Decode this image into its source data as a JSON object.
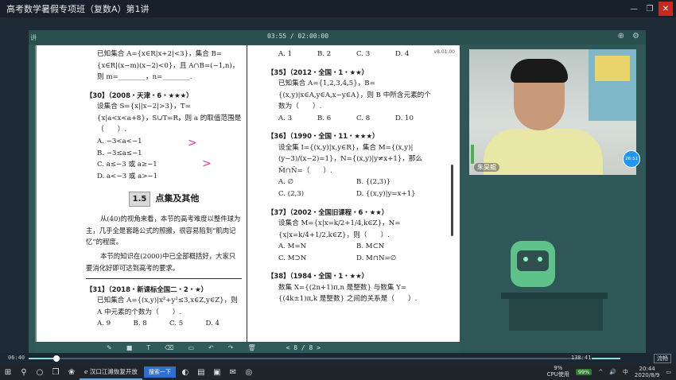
{
  "window": {
    "title": "高考数学暑假专项班（复数A）第1讲"
  },
  "player": {
    "back_label": "讲",
    "time": "03:55 / 02:00:00",
    "doc_corner": "v8.01.00"
  },
  "doc": {
    "left": {
      "q_prev_stem": "已知集合 A={x∈R|x+2|<3}，集合 B={x∈R|(x−m)(x−2)<0}，且 A∩B=(−1,n)，则 m=________，n=________.",
      "q30_head": "【30】（2008・天津・6・★★★）",
      "q30_stem": "设集合 S={x||x−2|>3}，T={x|a<x<a+8}，S∪T=R，则 a 的取值范围是（　　）.",
      "q30_options": [
        "A.  −3<a<−1",
        "B.  −3≤a≤−1",
        "C.  a≤−3 或 a≥−1",
        "D.  a<−3 或 a>−1"
      ],
      "section_num": "1.5",
      "section_title": "点集及其他",
      "para1": "从(40)的视角来看，本节的高考难度以整件球为主，几乎全是套路公式的照搬，很容易陷到“肌肉记忆”的程度。",
      "para2": "本节的知识在(2000)中已全部概括好，大家只要消化好即可达到高考的要求。",
      "q31_head": "【31】（2018・新课标全国二・2・★）",
      "q31_stem": "已知集合 A={(x,y)|x²+y²≤3,x∈Z,y∈Z}，则 A 中元素的个数为（　　）.",
      "q31_options": [
        "A.  9",
        "B.  8",
        "C.  5",
        "D.  4"
      ]
    },
    "right": {
      "q_prev_options": [
        "A.  1",
        "B.  2",
        "C.  3",
        "D.  4"
      ],
      "q35_head": "【35】（2012・全国・1・★★）",
      "q35_stem": "已知集合 A={1,2,3,4,5}，B={(x,y)|x∈A,y∈A,x−y∈A}，则 B 中所含元素的个数为（　　）.",
      "q35_options": [
        "A.  3",
        "B.  6",
        "C.  8",
        "D.  10"
      ],
      "q36_head": "【36】（1990・全国・11・★★★）",
      "q36_stem": "设全集 I={(x,y)|x,y∈R}，集合 M={(x,y)|(y−3)/(x−2)=1}，N={(x,y)|y≠x+1}，那么 M̄∩N̄=（　　）.",
      "q36_options": [
        "A.  ∅",
        "B.  {(2,3)}",
        "C.  (2,3)",
        "D.  {(x,y)|y=x+1}"
      ],
      "q37_head": "【37】（2002・全国旧课程・6・★★）",
      "q37_stem": "设集合 M={x|x=k/2+1/4,k∈Z}，N={x|x=k/4+1/2,k∈Z}，则（　　）.",
      "q37_options": [
        "A.  M=N",
        "B.  M⊂N",
        "C.  M⊃N",
        "D.  M∩N=∅"
      ],
      "q38_head": "【38】（1984・全国・1・★★）",
      "q38_stem": "数集 X={(2n+1)π,n 是整数} 与数集 Y={(4k±1)π,k 是整数} 之间的关系是（　　）."
    }
  },
  "doc_toolbar": {
    "pager": "< 8 / 8 >"
  },
  "webcam": {
    "name": "朱昊鲲",
    "timer": "26:31"
  },
  "progress": {
    "current": "06:40",
    "end": "138:41",
    "fraction": 0.05,
    "quality": "流畅"
  },
  "taskbar": {
    "app_label": "汉口江滩恢复开放",
    "search_label": "搜索一下",
    "cpu_value": "9%",
    "cpu_label": "CPU使用",
    "battery": "99%",
    "ime": "中",
    "time": "20:44",
    "date": "2020/8/9"
  },
  "colors": {
    "accent": "#2f5757",
    "ink": "#e0379a",
    "progress_fill": "#8fe0d0"
  }
}
